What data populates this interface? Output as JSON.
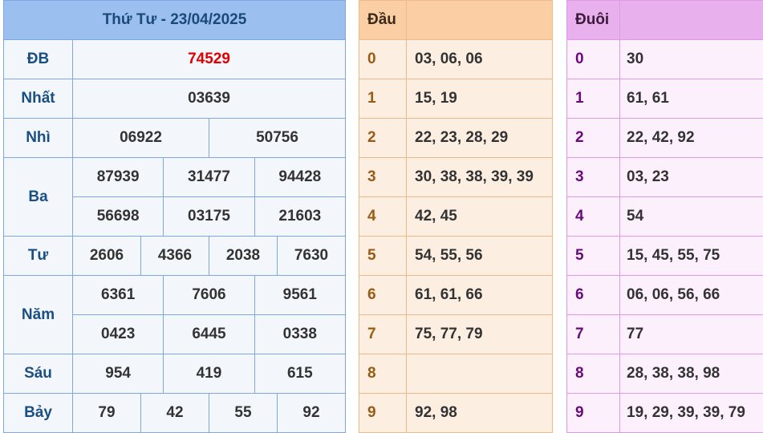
{
  "results": {
    "date_title": "Thứ Tư - 23/04/2025",
    "prizes": [
      {
        "label": "ĐB",
        "rows": [
          [
            "74529"
          ]
        ]
      },
      {
        "label": "Nhất",
        "rows": [
          [
            "03639"
          ]
        ]
      },
      {
        "label": "Nhì",
        "rows": [
          [
            "06922",
            "50756"
          ]
        ]
      },
      {
        "label": "Ba",
        "rows": [
          [
            "87939",
            "31477",
            "94428"
          ],
          [
            "56698",
            "03175",
            "21603"
          ]
        ]
      },
      {
        "label": "Tư",
        "rows": [
          [
            "2606",
            "4366",
            "2038",
            "7630"
          ]
        ]
      },
      {
        "label": "Năm",
        "rows": [
          [
            "6361",
            "7606",
            "9561"
          ],
          [
            "0423",
            "6445",
            "0338"
          ]
        ]
      },
      {
        "label": "Sáu",
        "rows": [
          [
            "954",
            "419",
            "615"
          ]
        ]
      },
      {
        "label": "Bảy",
        "rows": [
          [
            "79",
            "42",
            "55",
            "92"
          ]
        ]
      }
    ]
  },
  "heads": {
    "header": "Đầu",
    "rows": [
      {
        "key": "0",
        "values": "03, 06, 06"
      },
      {
        "key": "1",
        "values": "15, 19"
      },
      {
        "key": "2",
        "values": "22, 23, 28, 29"
      },
      {
        "key": "3",
        "values": "30, 38, 38, 39, 39"
      },
      {
        "key": "4",
        "values": "42, 45"
      },
      {
        "key": "5",
        "values": "54, 55, 56"
      },
      {
        "key": "6",
        "values": "61, 61, 66"
      },
      {
        "key": "7",
        "values": "75, 77, 79"
      },
      {
        "key": "8",
        "values": ""
      },
      {
        "key": "9",
        "values": "92, 98"
      }
    ]
  },
  "tails": {
    "header": "Đuôi",
    "rows": [
      {
        "key": "0",
        "values": "30"
      },
      {
        "key": "1",
        "values": "61, 61"
      },
      {
        "key": "2",
        "values": "22, 42, 92"
      },
      {
        "key": "3",
        "values": "03, 23"
      },
      {
        "key": "4",
        "values": "54"
      },
      {
        "key": "5",
        "values": "15, 45, 55, 75"
      },
      {
        "key": "6",
        "values": "06, 06, 56, 66"
      },
      {
        "key": "7",
        "values": "77"
      },
      {
        "key": "8",
        "values": "28, 38, 38, 98"
      },
      {
        "key": "9",
        "values": "19, 29, 39, 39, 79"
      }
    ]
  },
  "colors": {
    "special_prize": "#e00000",
    "results_header_bg": "#9bbfef",
    "heads_header_bg": "#fbcfa3",
    "tails_header_bg": "#e8b0ec"
  }
}
